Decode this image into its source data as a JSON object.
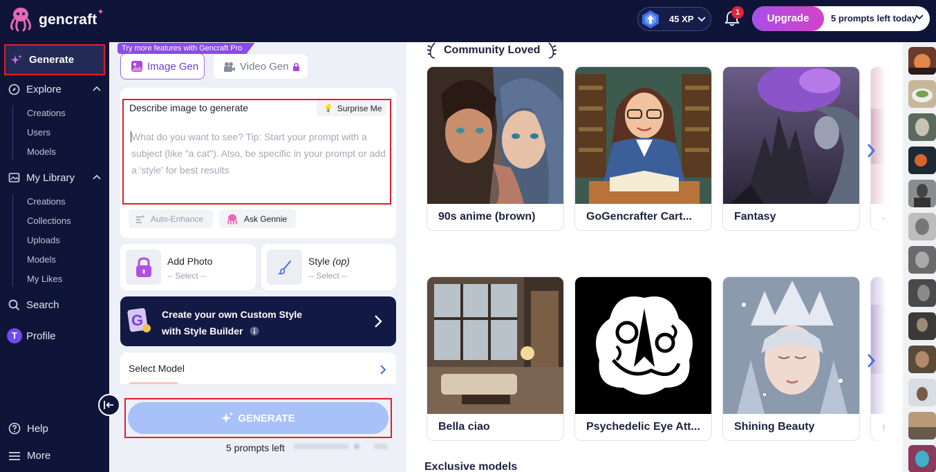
{
  "app": {
    "name": "gencraft"
  },
  "topbar": {
    "xp": "45 XP",
    "notifications_count": "1",
    "upgrade_label": "Upgrade",
    "prompts_left_today": "5 prompts left today"
  },
  "sidebar": {
    "generate": "Generate",
    "explore": "Explore",
    "explore_items": [
      "Creations",
      "Users",
      "Models"
    ],
    "library": "My Library",
    "library_items": [
      "Creations",
      "Collections",
      "Uploads",
      "Models",
      "My Likes"
    ],
    "search": "Search",
    "profile": "Profile",
    "profile_initial": "T",
    "help": "Help",
    "more": "More"
  },
  "generator": {
    "tab_image": "Image Gen",
    "tab_video": "Video Gen",
    "pro_ribbon": "Try more features with Gencraft Pro",
    "describe_label": "Describe image to generate",
    "surprise": "Surprise Me",
    "placeholder": "What do you want to see? Tip: Start your prompt with a subject (like \"a cat\"). Also, be specific in your prompt or add a 'style' for best results",
    "auto_enhance": "Auto-Enhance",
    "ask_gennie": "Ask Gennie",
    "add_photo": "Add Photo",
    "add_photo_sub": "-- Select --",
    "style": "Style",
    "style_opt": "(op)",
    "style_sub": "-- Select --",
    "builder_line1": "Create your own Custom Style",
    "builder_line2": "with Style Builder",
    "select_model": "Select Model",
    "generate_btn": "GENERATE",
    "prompts_left": "5 prompts left"
  },
  "community": {
    "title": "Community Loved",
    "row1": [
      "90s anime (brown)",
      "GoGencrafter Cart...",
      "Fantasy",
      "J"
    ],
    "row2": [
      "Bella ciao",
      "Psychedelic Eye Att...",
      "Shining Beauty",
      "g"
    ]
  },
  "exclusive": {
    "title": "Exclusive models"
  },
  "colors": {
    "nav_bg": "#0f1538",
    "accent_purple": "#9b63e6",
    "highlight_red": "#e01e2c",
    "generate_btn": "#a8c1f8"
  }
}
